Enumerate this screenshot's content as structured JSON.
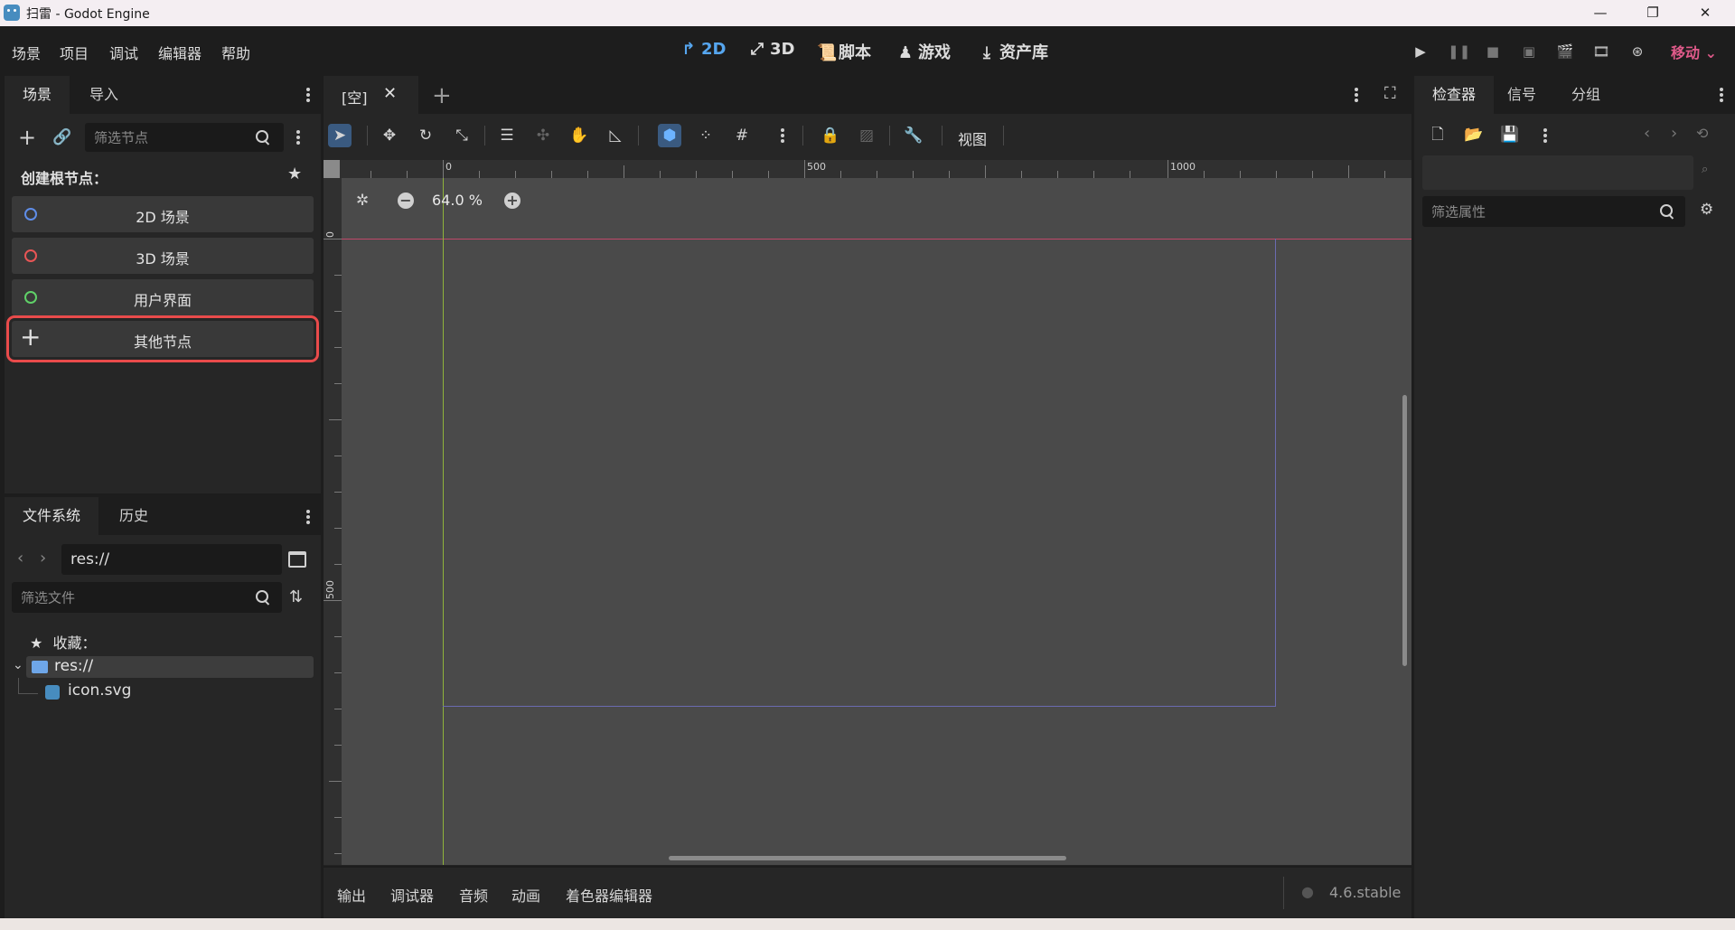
{
  "window": {
    "title": "扫雷 - Godot Engine",
    "minimize": "—",
    "maximize": "❐",
    "close": "✕"
  },
  "menu": {
    "items": [
      "场景",
      "项目",
      "调试",
      "编辑器",
      "帮助"
    ]
  },
  "modes": [
    {
      "label": "2D",
      "icon": "2d-arrows-icon",
      "active": true
    },
    {
      "label": "3D",
      "icon": "3d-arrows-icon",
      "active": false
    },
    {
      "label": "脚本",
      "icon": "script-icon",
      "active": false
    },
    {
      "label": "游戏",
      "icon": "game-icon",
      "active": false
    },
    {
      "label": "资产库",
      "icon": "download-icon",
      "active": false
    }
  ],
  "renderer": "移动",
  "colors": {
    "accent": "#56a6ef",
    "renderer": "#e05a8a",
    "highlight_box": "#e94b4b",
    "circle_2d": "#5f8de8",
    "circle_3d": "#e85555",
    "circle_ui": "#5fd068"
  },
  "scene_dock": {
    "tabs": [
      "场景",
      "导入"
    ],
    "filter_placeholder": "筛选节点",
    "create_root_label": "创建根节点：",
    "nodes": [
      "2D 场景",
      "3D 场景",
      "用户界面",
      "其他节点"
    ]
  },
  "filesystem_dock": {
    "tabs": [
      "文件系统",
      "历史"
    ],
    "path": "res://",
    "filter_placeholder": "筛选文件",
    "favorites_label": "收藏：",
    "tree": [
      {
        "name": "res://",
        "type": "folder"
      },
      {
        "name": "icon.svg",
        "type": "file"
      }
    ]
  },
  "editor": {
    "scene_tab": "[空]",
    "zoom": "64.0 %",
    "view_menu": "视图",
    "ruler_top": [
      "0",
      "500",
      "1000"
    ],
    "ruler_left": [
      "0",
      "500"
    ]
  },
  "bottom_panel": {
    "tabs": [
      "输出",
      "调试器",
      "音频",
      "动画",
      "着色器编辑器"
    ],
    "version": "4.6.stable"
  },
  "inspector": {
    "tabs": [
      "检查器",
      "信号",
      "分组"
    ],
    "filter_placeholder": "筛选属性"
  }
}
